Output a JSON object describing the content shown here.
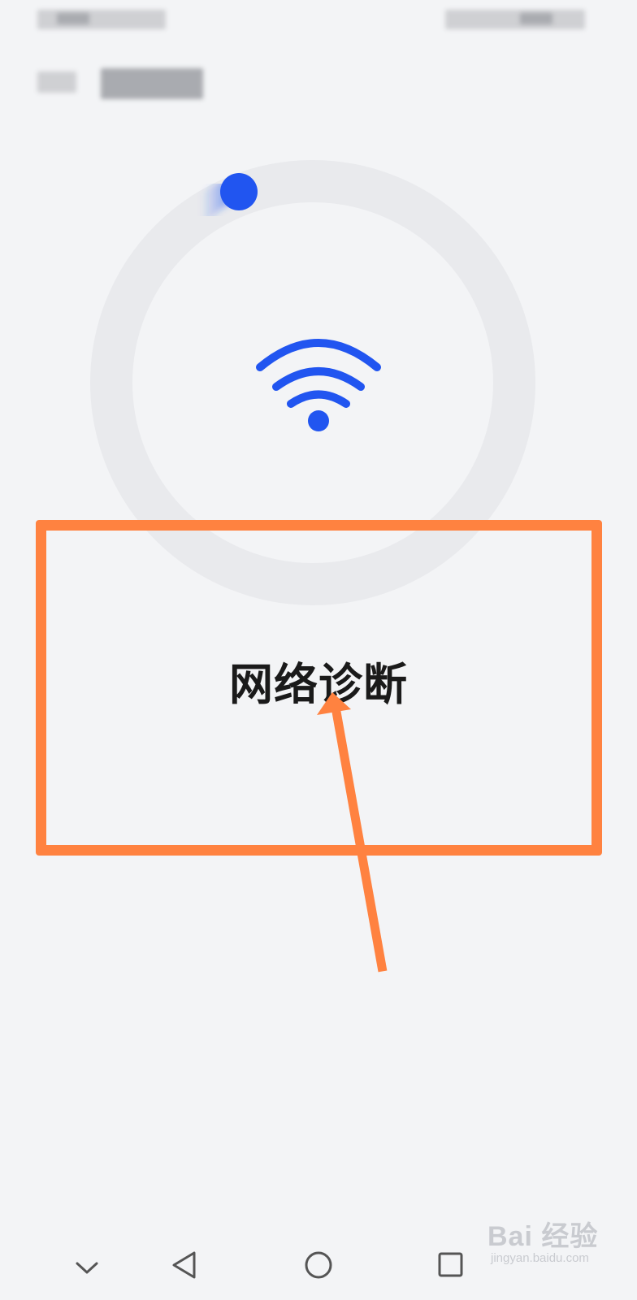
{
  "title": "网络诊断",
  "icons": {
    "wifi": "wifi-icon",
    "nav_back": "triangle-back-icon",
    "nav_home": "circle-home-icon",
    "nav_recent": "square-recent-icon",
    "nav_collapse": "chevron-down-icon"
  },
  "colors": {
    "accent": "#2155f0",
    "ring": "#e9eaed",
    "annotation": "#ff8240",
    "background": "#f3f4f6"
  },
  "watermark": {
    "main": "Bai 经验",
    "sub": "jingyan.baidu.com"
  }
}
